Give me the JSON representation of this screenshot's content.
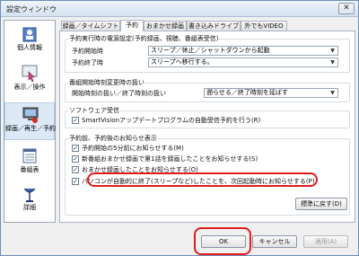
{
  "window": {
    "title": "設定ウィンドウ",
    "close_glyph": "✕"
  },
  "sidebar": {
    "items": [
      {
        "label": "個人情報",
        "icon": "person-card-icon"
      },
      {
        "label": "表示／操作",
        "icon": "hand-cursor-icon"
      },
      {
        "label": "録画／再生／予約",
        "icon": "tv-recording-icon"
      },
      {
        "label": "番組表",
        "icon": "program-guide-icon"
      },
      {
        "label": "詳細",
        "icon": "antenna-icon"
      }
    ],
    "selected_index": 2
  },
  "tabs": [
    {
      "label": "録画／タイムシフト"
    },
    {
      "label": "予約"
    },
    {
      "label": "おまかせ録画"
    },
    {
      "label": "書き込みドライブ"
    },
    {
      "label": "外でもVIDEO"
    }
  ],
  "active_tab": 1,
  "groups": {
    "power": {
      "title": "予約実行時の電源設定(予約録画、視聴、番組表受信)",
      "start_label": "予約開始時",
      "start_value": "スリープ／休止／シャットダウンから起動",
      "end_label": "予約終了時",
      "end_value": "スリープへ移行する。"
    },
    "change": {
      "title": "番組開始時刻変更時の扱い",
      "label": "開始時刻の扱い／終了時刻の扱い",
      "value": "遡らせる／終了時刻を延ばす"
    },
    "software": {
      "title": "ソフトウェア受信",
      "check_label": "SmartVisionアップデートプログラムの自動受信予約を行う(R)",
      "checked": true
    },
    "notify": {
      "title": "予約前、予約後のお知らせ表示",
      "items": [
        {
          "label": "予約開始の5分前にお知らせする(M)",
          "checked": true
        },
        {
          "label": "新番組おまかせ録画で第1話を録画したことをお知らせする(S)",
          "checked": true
        },
        {
          "label": "おまかせ録画したことをお知らせする(O)",
          "checked": true
        },
        {
          "label": "パソコンが自動的に終了(スリープなど)したことを、次回起動時にお知らせする(P)",
          "checked": true
        }
      ]
    }
  },
  "buttons": {
    "default": "標準に戻す(D)",
    "ok": "OK",
    "cancel": "キャンセル",
    "apply": "適用(A)"
  },
  "colors": {
    "highlight": "#e21c1c",
    "accent": "#1a3e7a"
  }
}
